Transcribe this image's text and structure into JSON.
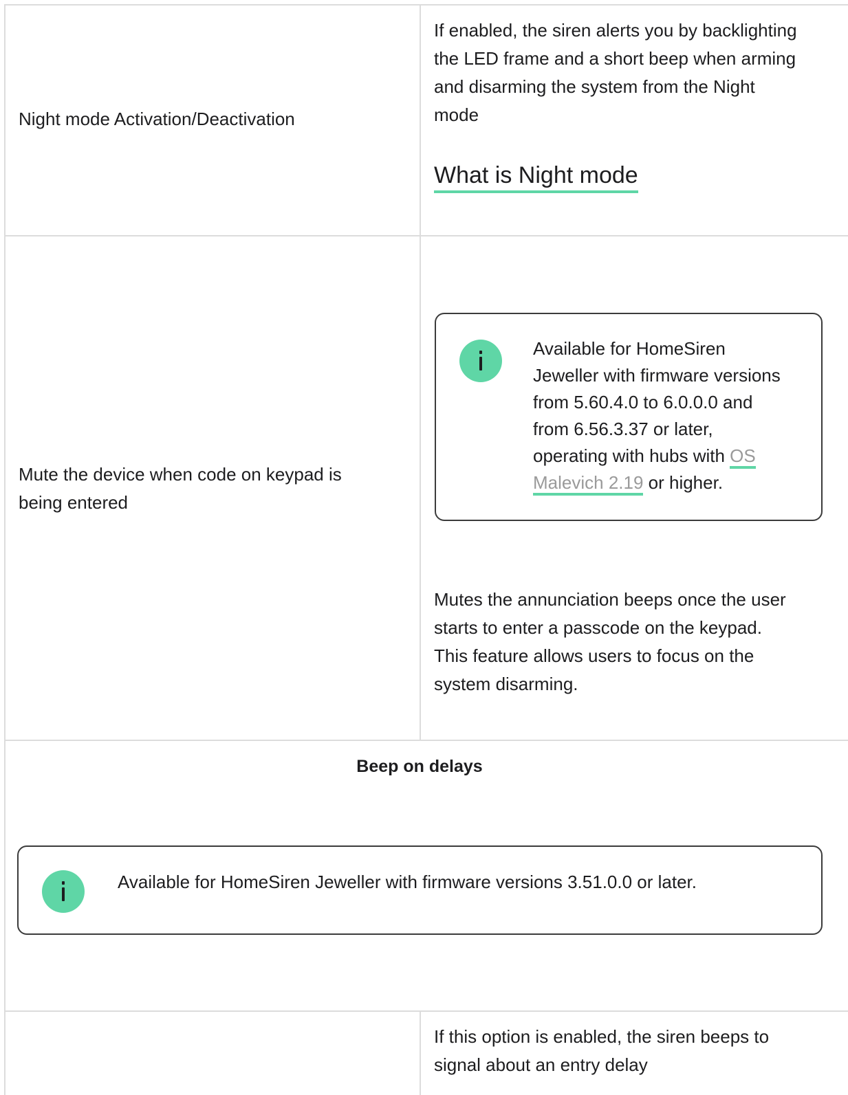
{
  "rows": [
    {
      "setting": "Night mode Activation/Deactivation",
      "description_lines": [
        "If enabled, the siren alerts you by backlighting",
        "the LED frame and a short beep when arming",
        "and disarming the system from the Night",
        "mode"
      ],
      "link_label": "What is Night mode"
    },
    {
      "setting_lines": [
        "Mute the device when code on keypad is",
        "being entered"
      ],
      "note": {
        "icon": "info-icon",
        "lines": [
          "Available for HomeSiren",
          "Jeweller with firmware versions",
          "from 5.60.4.0 to 6.0.0.0 and",
          "from 6.56.3.37 or later,"
        ],
        "line5_before": "operating with hubs with ",
        "link_part1": "OS",
        "link_part2": "Malevich 2.19",
        "line6_after": " or higher."
      },
      "description_lines": [
        "Mutes the annunciation beeps once the user",
        "starts to enter a passcode on the keypad.",
        "This feature allows users to focus on the",
        "system disarming."
      ]
    }
  ],
  "section": {
    "title": "Beep on delays",
    "note": {
      "icon": "info-icon",
      "text": "Available for HomeSiren Jeweller with firmware versions 3.51.0.0 or later."
    }
  },
  "last_row": {
    "description_lines": [
      "If this option is enabled, the siren beeps to",
      "signal about an entry delay"
    ]
  },
  "colors": {
    "accent": "#5fd6a6",
    "border": "#dcdcdc",
    "link_text": "#9a9a9a"
  }
}
